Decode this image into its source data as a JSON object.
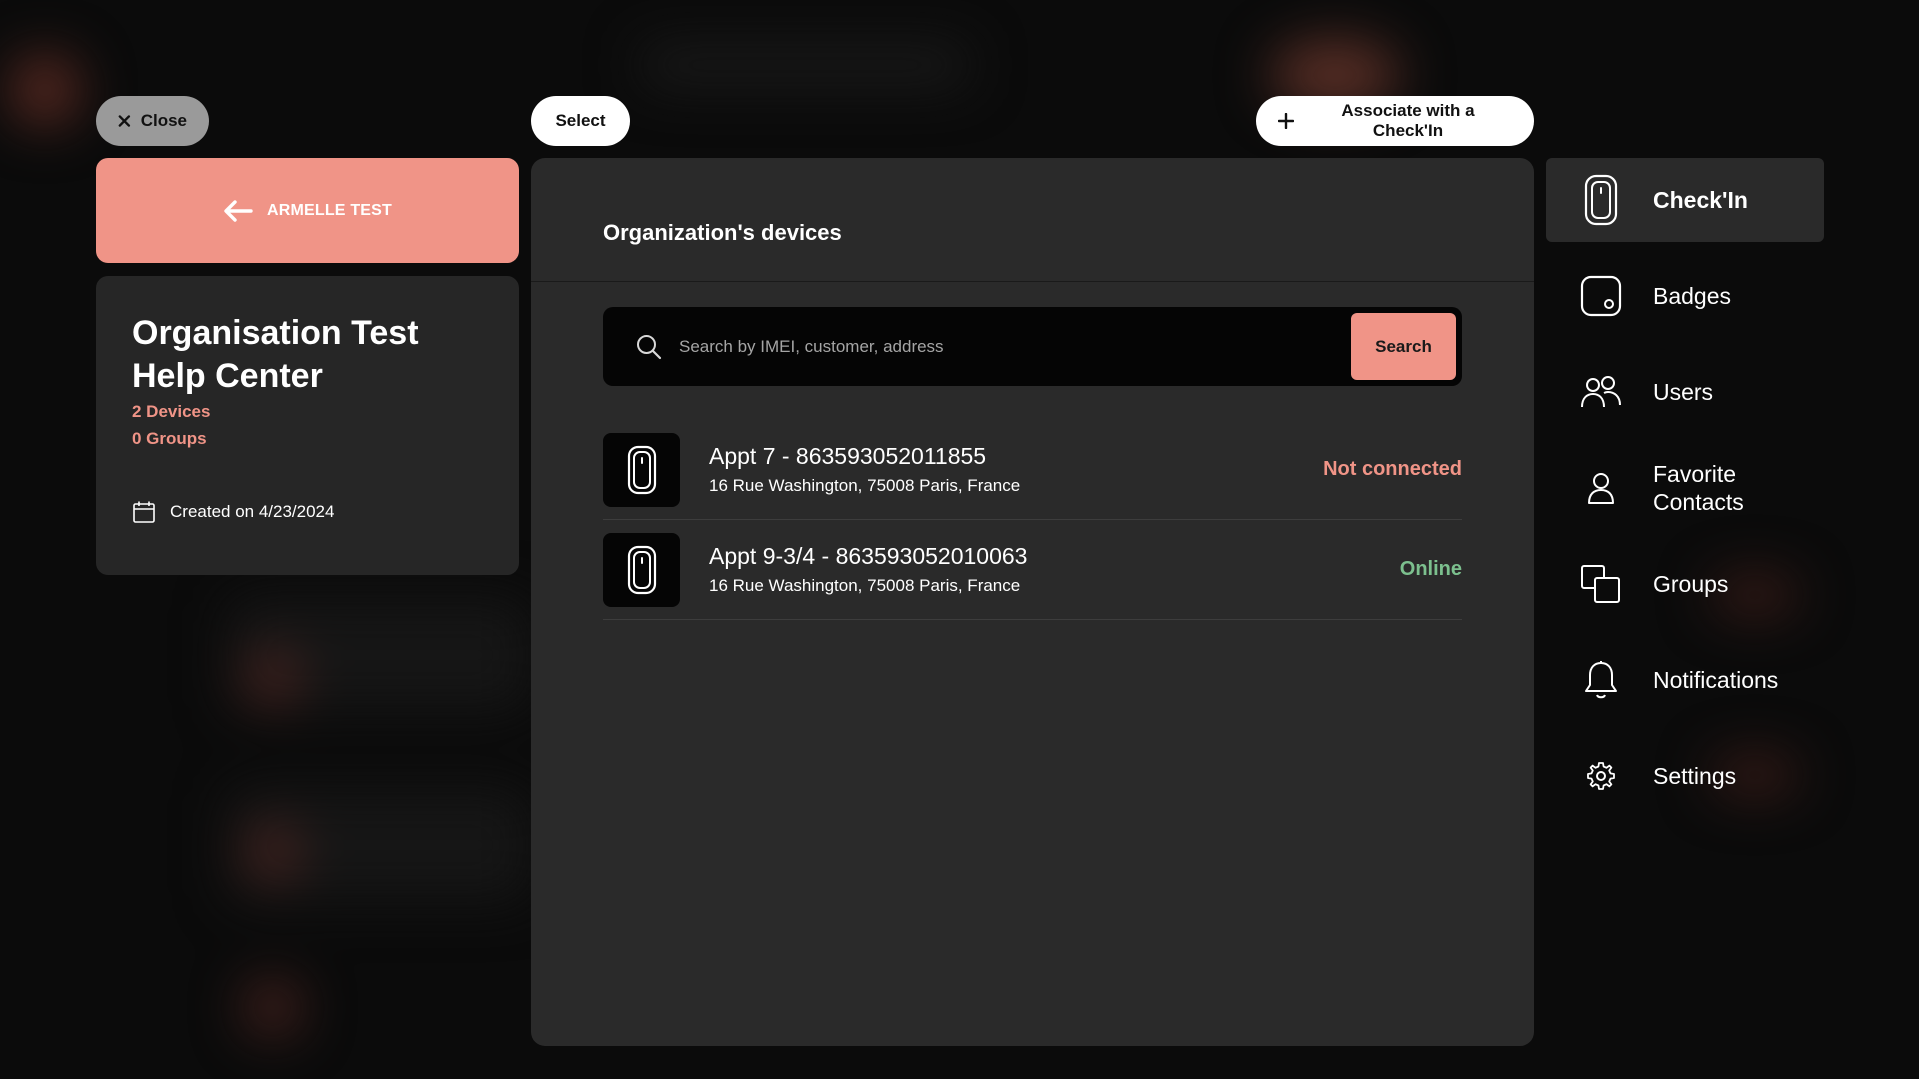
{
  "top_bar": {
    "close_label": "Close",
    "select_label": "Select",
    "associate_label": "Associate with a Check'In"
  },
  "back_card": {
    "label": "ARMELLE TEST"
  },
  "organization": {
    "title_line1": "Organisation Test",
    "title_line2": "Help Center",
    "devices_count": "2 Devices",
    "groups_count": "0 Groups",
    "created": "Created on 4/23/2024"
  },
  "main": {
    "title": "Organization's devices",
    "search_placeholder": "Search by IMEI, customer, address",
    "search_button": "Search",
    "devices": [
      {
        "name": "Appt 7 - 863593052011855",
        "address": "16 Rue Washington, 75008 Paris, France",
        "status": "Not connected",
        "status_color": "#f09487"
      },
      {
        "name": "Appt 9-3/4 - 863593052010063",
        "address": "16 Rue Washington, 75008 Paris, France",
        "status": "Online",
        "status_color": "#7cc08e"
      }
    ]
  },
  "side_nav": {
    "items": [
      {
        "label": "Check'In",
        "icon": "checkin-device-icon",
        "active": true
      },
      {
        "label": "Badges",
        "icon": "badge-icon"
      },
      {
        "label": "Users",
        "icon": "users-icon"
      },
      {
        "label": "Favorite Contacts",
        "icon": "contact-icon"
      },
      {
        "label": "Groups",
        "icon": "groups-icon"
      },
      {
        "label": "Notifications",
        "icon": "bell-icon"
      },
      {
        "label": "Settings",
        "icon": "gear-icon"
      }
    ]
  },
  "colors": {
    "accent": "#f09487",
    "online": "#7cc08e",
    "panel": "#2a2a2a"
  }
}
